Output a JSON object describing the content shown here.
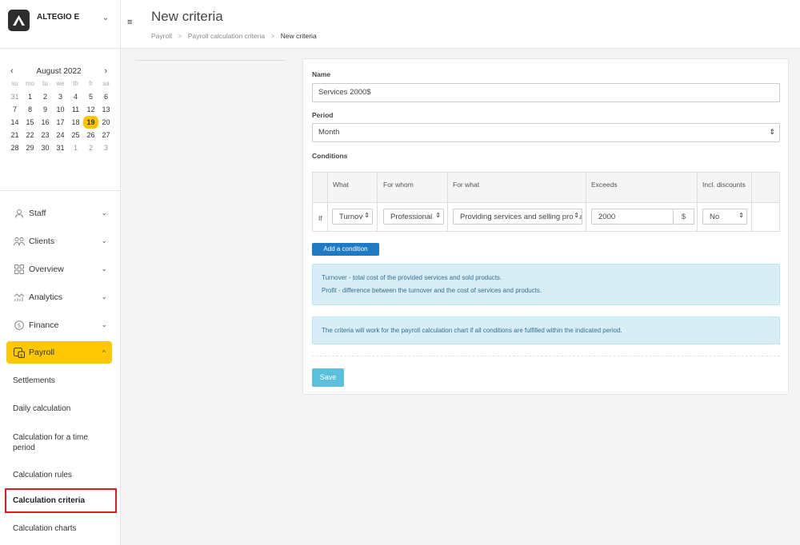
{
  "brand": {
    "name": "ALTEGIO E",
    "caret": "⌄"
  },
  "calendar": {
    "month": "August 2022",
    "prev": "‹",
    "next": "›",
    "weekdays": [
      "su",
      "mo",
      "tu",
      "we",
      "th",
      "fr",
      "sa"
    ],
    "weeks": [
      [
        "31",
        "1",
        "2",
        "3",
        "4",
        "5",
        "6"
      ],
      [
        "7",
        "8",
        "9",
        "10",
        "11",
        "12",
        "13"
      ],
      [
        "14",
        "15",
        "16",
        "17",
        "18",
        "19",
        "20"
      ],
      [
        "21",
        "22",
        "23",
        "24",
        "25",
        "26",
        "27"
      ],
      [
        "28",
        "29",
        "30",
        "31",
        "1",
        "2",
        "3"
      ]
    ],
    "selected": "19"
  },
  "menu": [
    {
      "label": "Staff",
      "icon": "person-icon",
      "caret": "⌄"
    },
    {
      "label": "Clients",
      "icon": "people-icon",
      "caret": "⌄"
    },
    {
      "label": "Overview",
      "icon": "grid-icon",
      "caret": "⌄"
    },
    {
      "label": "Analytics",
      "icon": "analytics-icon",
      "caret": "⌄"
    },
    {
      "label": "Finance",
      "icon": "coin-icon",
      "caret": "⌄"
    },
    {
      "label": "Payroll",
      "icon": "payroll-icon",
      "caret": "^"
    }
  ],
  "submenu": [
    "Settlements",
    "Daily calculation",
    "Calculation for a time period",
    "Calculation rules",
    "Calculation criteria",
    "Calculation charts"
  ],
  "header": {
    "menu_icon": "≡",
    "title": "New criteria",
    "breadcrumb": [
      "Payroll",
      "Payroll calculation criteria",
      "New criteria"
    ],
    "separator": ">"
  },
  "form": {
    "name_label": "Name",
    "name_value": "Services 2000$",
    "period_label": "Period",
    "period_value": "Month",
    "conditions_label": "Conditions",
    "columns": {
      "what": "What",
      "for_whom": "For whom",
      "for_what": "For what",
      "exceeds": "Exceeds",
      "incl_discounts": "Incl. discounts"
    },
    "row": {
      "prefix": "If",
      "what": "Turnover",
      "for_whom": "Professional",
      "for_what": "Providing services and selling products",
      "exceeds": "2000",
      "currency": "$",
      "incl_discounts": "No"
    },
    "add_condition": "Add a condition",
    "info_lines": [
      "Turnover - total cost of the provided services and sold products.",
      "Profit - difference between the turnover and the cost of services and products."
    ],
    "note": "The criteria will work for the payroll calculation chart if all conditions are fulfilled within the indicated period.",
    "save": "Save",
    "select_arrow": "⇕"
  }
}
